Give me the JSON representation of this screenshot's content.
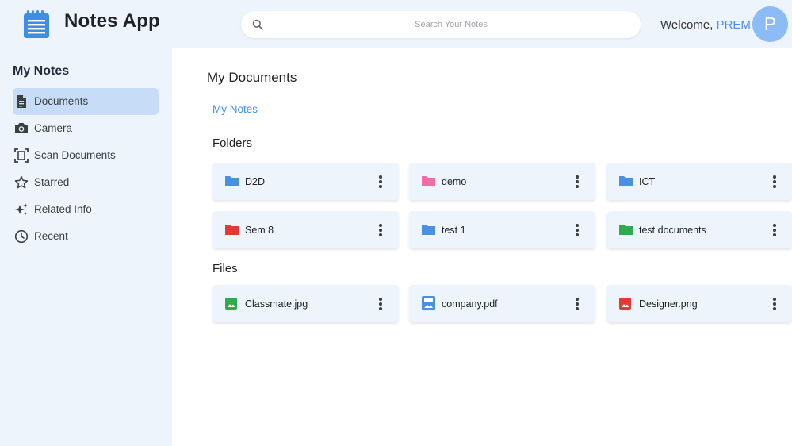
{
  "header": {
    "app_title": "Notes App",
    "search_placeholder": "Search Your Notes",
    "welcome_prefix": "Welcome, ",
    "user_name": "PREM",
    "avatar_initial": "P"
  },
  "sidebar": {
    "title": "My Notes",
    "items": [
      {
        "label": "Documents",
        "icon": "document-icon",
        "active": true
      },
      {
        "label": "Camera",
        "icon": "camera-icon",
        "active": false
      },
      {
        "label": "Scan Documents",
        "icon": "scan-icon",
        "active": false
      },
      {
        "label": "Starred",
        "icon": "star-icon",
        "active": false
      },
      {
        "label": "Related Info",
        "icon": "sparkle-icon",
        "active": false
      },
      {
        "label": "Recent",
        "icon": "clock-icon",
        "active": false
      }
    ]
  },
  "main": {
    "title": "My Documents",
    "breadcrumb": "My Notes",
    "folders_title": "Folders",
    "files_title": "Files",
    "folders": [
      {
        "name": "D2D",
        "color": "#4a90e2"
      },
      {
        "name": "demo",
        "color": "#f06ba8"
      },
      {
        "name": "ICT",
        "color": "#4a90e2"
      },
      {
        "name": "Sem 8",
        "color": "#e53935"
      },
      {
        "name": "test 1",
        "color": "#4a90e2"
      },
      {
        "name": "test documents",
        "color": "#2eaa4f"
      }
    ],
    "files": [
      {
        "name": "Classmate.jpg",
        "icon": "image-file-icon",
        "color": "#2eaa4f"
      },
      {
        "name": "company.pdf",
        "icon": "pdf-file-icon",
        "color": "#4a90e2"
      },
      {
        "name": "Designer.png",
        "icon": "image-file-icon",
        "color": "#e53935"
      }
    ]
  },
  "colors": {
    "accent": "#4a8ee8",
    "active_nav": "#c6dcf7",
    "background": "#eef4fc"
  }
}
